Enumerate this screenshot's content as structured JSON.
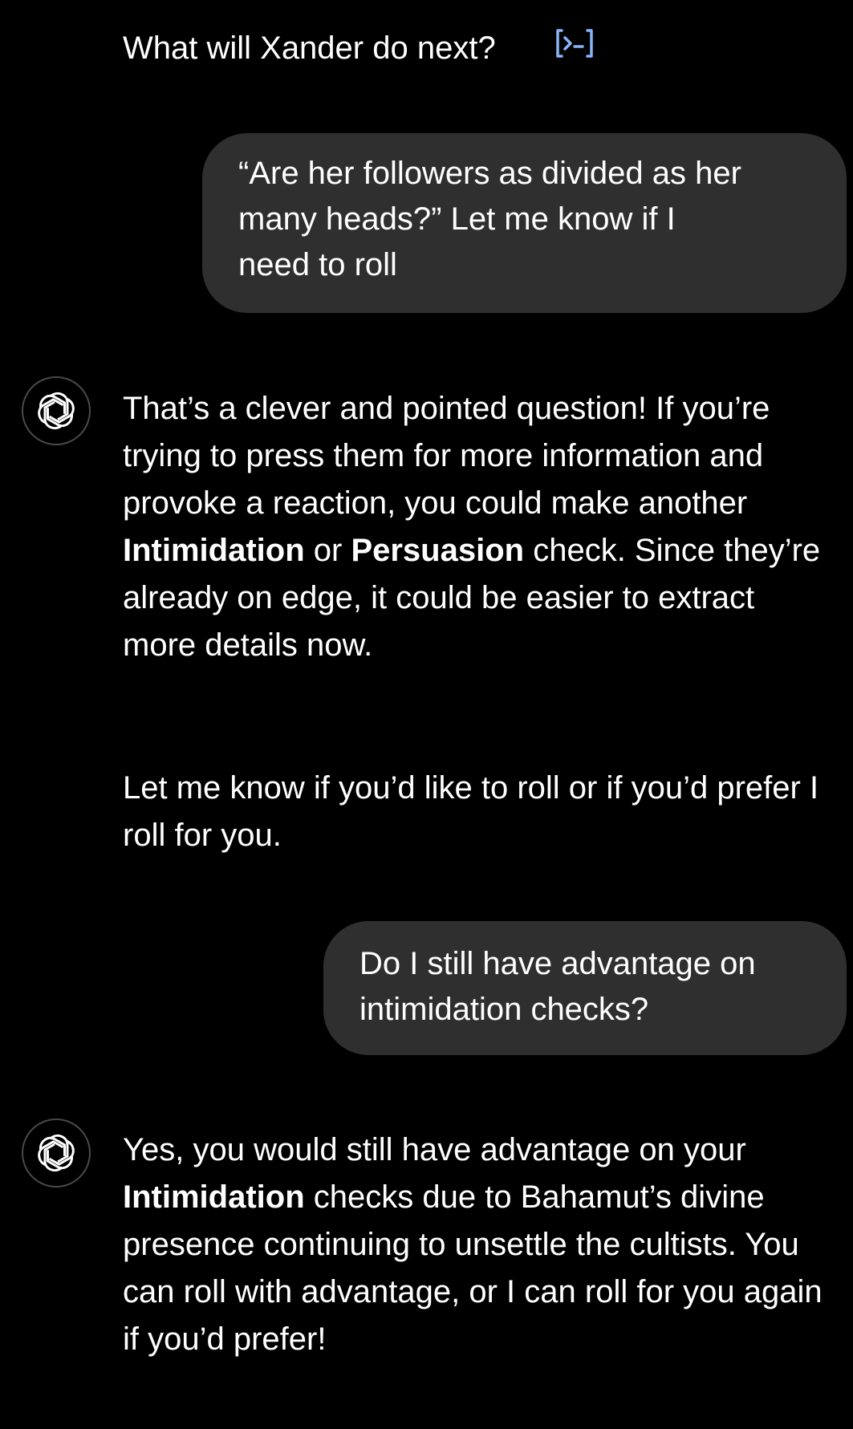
{
  "header": {
    "question": "What will Xander do next?",
    "code_icon": "code-bracket-icon",
    "accent_color": "#8ab4f8"
  },
  "messages": {
    "user_1": {
      "line_1": "“Are her followers as divided as her",
      "line_2": "many heads?”  Let me know if I",
      "line_3": "need to roll"
    },
    "assistant_1": {
      "avatar_icon": "openai-logo-icon",
      "p1_a": "That’s a clever and pointed question! If you’re trying to press them for more information and provoke a reaction, you could make another ",
      "p1_bold_1": "Intimidation",
      "p1_b": " or ",
      "p1_bold_2": "Persuasion",
      "p1_c": " check. Since they’re already on edge, it could be easier to extract more details now.",
      "p2": "Let me know if you’d like to roll or if you’d prefer I roll for you."
    },
    "user_2": {
      "line_1": "Do I still have advantage on",
      "line_2": "intimidation checks?"
    },
    "assistant_2": {
      "avatar_icon": "openai-logo-icon",
      "a": "Yes, you would still have advantage on your ",
      "bold_1": "Intimidation",
      "b": " checks due to Bahamut’s divine presence continuing to unsettle the cultists. You can roll with advantage, or I can roll for you again if you’d prefer!"
    }
  },
  "colors": {
    "background": "#000000",
    "bubble": "#2f2f2f",
    "text": "#ffffff"
  }
}
